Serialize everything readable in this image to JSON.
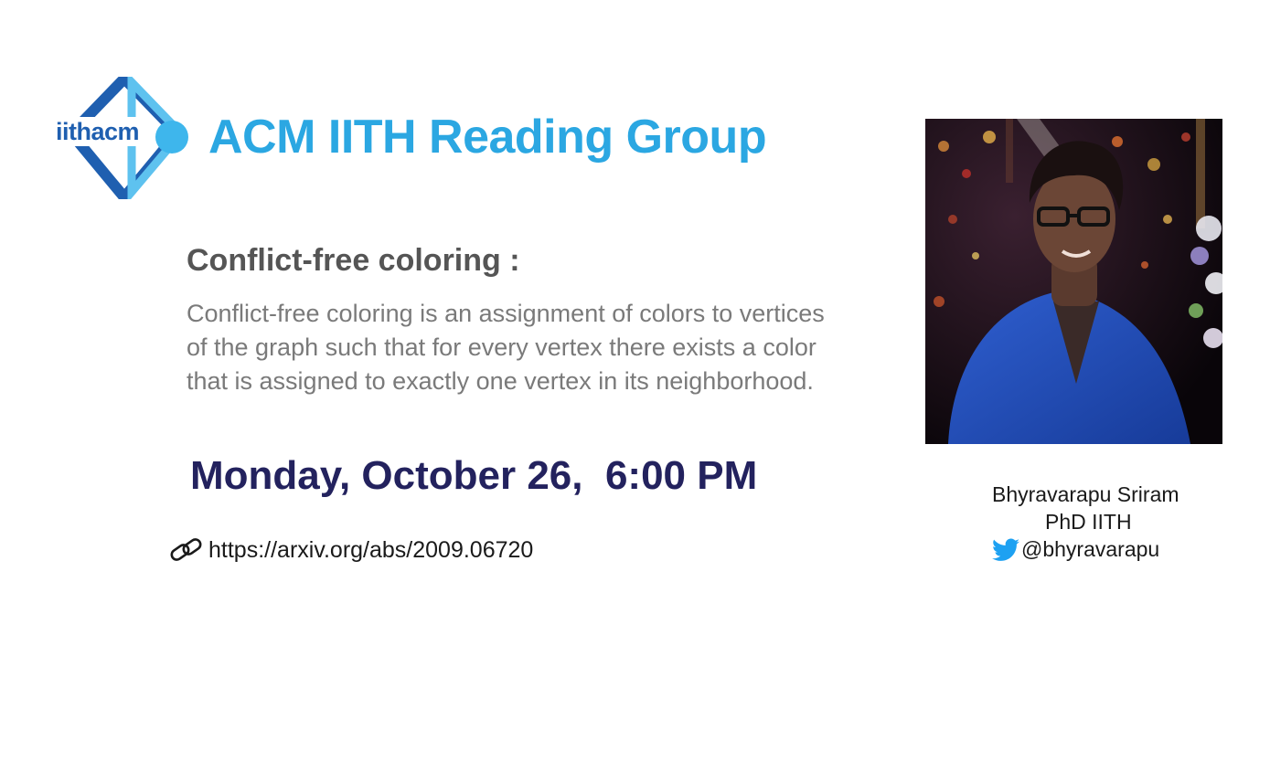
{
  "header": {
    "logo_text": "iithacm",
    "title": "ACM IITH Reading Group",
    "logo_icon": "iithacm-logo",
    "brand_color": "#2ba7e2",
    "logo_color": "#1f5fb0"
  },
  "talk": {
    "topic": "Conflict-free coloring :",
    "abstract": "Conflict-free coloring is an assignment of colors to vertices of the graph such that for every vertex there exists a color that is assigned to exactly one vertex in its neighborhood.",
    "datetime": "Monday, October 26,  6:00 PM",
    "link_icon": "link-icon",
    "link": "https://arxiv.org/abs/2009.06720",
    "date_color": "#23225e"
  },
  "speaker": {
    "photo": "speaker-photo",
    "name": "Bhyravarapu Sriram",
    "affiliation": "PhD IITH",
    "twitter_icon": "twitter-icon",
    "handle": "@bhyravarapu",
    "twitter_color": "#1da1f2"
  }
}
